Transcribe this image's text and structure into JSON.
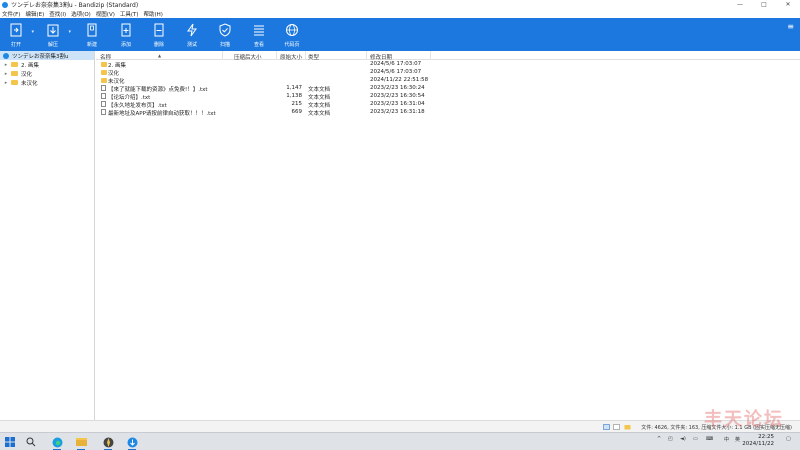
{
  "window": {
    "title": "ツンデレお奈奈集3割u - Bandizip (Standard)",
    "minimize": "—",
    "maximize": "□",
    "close": "✕"
  },
  "menu": [
    "文件(F)",
    "编辑(E)",
    "查找(I)",
    "选项(O)",
    "视图(V)",
    "工具(T)",
    "帮助(H)"
  ],
  "toolbar": {
    "open": "打开",
    "extract": "解压",
    "new": "新建",
    "add": "添加",
    "delete": "删除",
    "test": "测试",
    "scan": "扫描",
    "view": "查看",
    "codepage": "代码页",
    "menu_icon": "≡"
  },
  "tree": {
    "root": "ツンデレお奈奈集3割u",
    "items": [
      "2. 画集",
      "汉化",
      "未汉化"
    ]
  },
  "list": {
    "headers": {
      "name": "名称",
      "packed": "压缩后大小",
      "size": "原始大小",
      "type": "类型",
      "date": "修改日期"
    },
    "rows": [
      {
        "icon": "folder",
        "name": "2. 画集",
        "size": "",
        "type": "",
        "date": "2024/5/6 17:03:07"
      },
      {
        "icon": "folder",
        "name": "汉化",
        "size": "",
        "type": "",
        "date": "2024/5/6 17:03:07"
      },
      {
        "icon": "folder",
        "name": "未汉化",
        "size": "",
        "type": "",
        "date": "2024/11/22 22:51:58"
      },
      {
        "icon": "txt",
        "name": "【來了就能下载的资源》点免费!！】.txt",
        "size": "1,147",
        "type": "文本文档",
        "date": "2023/2/23 16:30:24"
      },
      {
        "icon": "txt",
        "name": "【论坛介绍】.txt",
        "size": "1,138",
        "type": "文本文档",
        "date": "2023/2/23 16:30:54"
      },
      {
        "icon": "txt",
        "name": "【永久地址发布页】.txt",
        "size": "215",
        "type": "文本文档",
        "date": "2023/2/23 16:31:04"
      },
      {
        "icon": "txt",
        "name": "最新地址及APP请按前律自动获取！！！.txt",
        "size": "669",
        "type": "文本文档",
        "date": "2023/2/23 16:31:18"
      }
    ]
  },
  "status": {
    "text": "文件: 4626, 文件夹: 163, 压缩文件大小: 1.1 GB (固实压缩无压缩)",
    "watermark": "丰天论坛"
  },
  "taskbar": {
    "tray_lang": "中",
    "tray_ime": "英",
    "time": "22:25",
    "date": "2024/11/22"
  },
  "colors": {
    "toolbar": "#1c78de",
    "selection": "#cde3f8",
    "folder": "#f3c64b"
  }
}
